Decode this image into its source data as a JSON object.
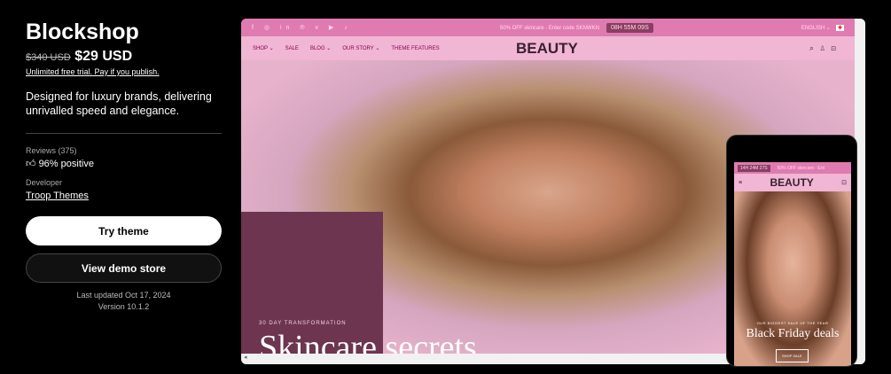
{
  "listing": {
    "title": "Blockshop",
    "old_price": "$340 USD",
    "price": "$29 USD",
    "trial": "Unlimited free trial",
    "trial_note": ". Pay if you publish.",
    "description": "Designed for luxury brands, delivering unrivalled speed and elegance.",
    "reviews_label": "Reviews (375)",
    "reviews_value": "96% positive",
    "developer_label": "Developer",
    "developer": "Troop Themes",
    "try_button": "Try theme",
    "demo_button": "View demo store",
    "updated": "Last updated Oct 17, 2024",
    "version": "Version 10.1.2"
  },
  "desktop": {
    "social": "f ◎ in ℗ v ▶ ♪",
    "announcement": "50% OFF skincare - Enter code SKNWKN",
    "timer": "08H 55M 09S",
    "language": "ENGLISH ⌄",
    "nav": [
      "SHOP ⌄",
      "SALE",
      "BLOG ⌄",
      "OUR STORY ⌄",
      "THEME FEATURES"
    ],
    "logo": "BEAUTY",
    "hero_kicker": "30 DAY TRANSFORMATION",
    "hero_title": "Skincare secrets"
  },
  "mobile": {
    "timer": "14H 24M 27S",
    "announcement": "50% OFF skincare - Ent",
    "logo": "BEAUTY",
    "hero_kicker": "OUR BIGGEST SALE OF THE YEAR",
    "hero_title": "Black Friday deals",
    "button": "SHOP SALE"
  }
}
